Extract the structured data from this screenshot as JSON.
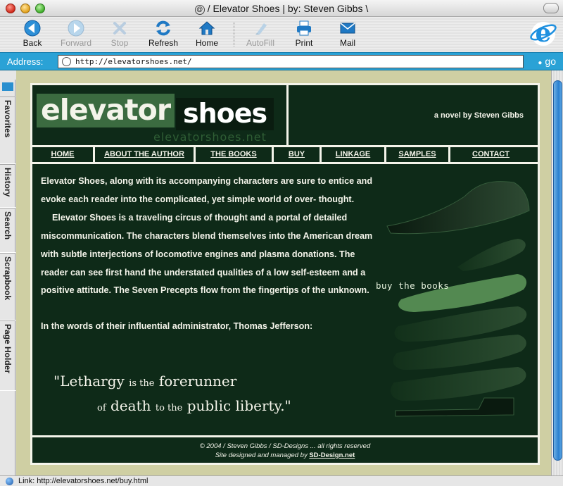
{
  "window": {
    "title": "/ Elevator Shoes | by: Steven Gibbs \\"
  },
  "toolbar": {
    "back": "Back",
    "forward": "Forward",
    "stop": "Stop",
    "refresh": "Refresh",
    "home": "Home",
    "autofill": "AutoFill",
    "print": "Print",
    "mail": "Mail"
  },
  "address": {
    "label": "Address:",
    "url": "http://elevatorshoes.net/",
    "go": "go"
  },
  "explorer_tabs": [
    "Favorites",
    "History",
    "Search",
    "Scrapbook",
    "Page Holder"
  ],
  "status": {
    "text": "Link: http://elevatorshoes.net/buy.html"
  },
  "site": {
    "logo": {
      "word1": "elevator",
      "word2": "shoes",
      "url": "elevatorshoes.net"
    },
    "tagline": "a novel by Steven Gibbs",
    "nav": [
      "HOME",
      "ABOUT THE AUTHOR",
      "THE BOOKS",
      "BUY",
      "LINKAGE",
      "SAMPLES",
      "CONTACT"
    ],
    "paragraph1": "Elevator Shoes, along with its accompanying characters are sure to entice and evoke each reader into the complicated, yet simple world of over- thought.",
    "paragraph2": "Elevator Shoes is a traveling circus of thought and a portal of detailed miscommunication. The characters blend themselves into the American dream with subtle interjections of locomotive engines and plasma donations. The reader can see first hand the understated qualities of a low self-esteem and a positive attitude. The Seven Precepts flow from the fingertips of the unknown.",
    "paragraph3": "In the words of their influential administrator, Thomas Jefferson:",
    "quote": {
      "p1": "\"Lethargy",
      "p2": "is the",
      "p3": "forerunner",
      "p4": "of",
      "p5": "death",
      "p6": "to the",
      "p7": "public liberty.\""
    },
    "buy_books": "buy the books",
    "footer": {
      "line1": "© 2004 / Steven Gibbs / SD-Designs ... all rights reserved",
      "line2_prefix": "Site designed and managed by",
      "line2_link": "SD-Design.net"
    }
  },
  "colors": {
    "page_bg": "#0e2a18",
    "frame": "#cfcfa3",
    "addressbar": "#2aa2d6",
    "accent": "#7fc87a"
  }
}
